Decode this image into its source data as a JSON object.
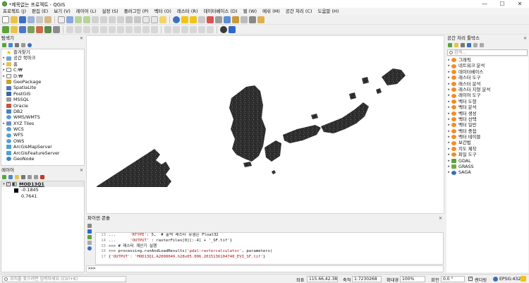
{
  "window": {
    "title": "*제목없는 프로젝트 - QGIS",
    "controls": [
      "—",
      "☐",
      "✕"
    ]
  },
  "menubar": [
    "프로젝트 (J)",
    "편집 (E)",
    "보기 (V)",
    "레이어 (L)",
    "설정 (S)",
    "플러그인 (P)",
    "벡터 (O)",
    "래스터 (R)",
    "데이터베이스 (D)",
    "웹 (W)",
    "메쉬 (M)",
    "공간 처리 (C)",
    "도움말 (H)"
  ],
  "browser_panel": {
    "title": "탐색기",
    "items": [
      {
        "label": "즐겨찾기",
        "icon": "star-icon",
        "arrow": ""
      },
      {
        "label": "공간 북마크",
        "icon": "bookmark-icon",
        "arrow": "▸"
      },
      {
        "label": "홈",
        "icon": "home-folder-icon",
        "arrow": "▸"
      },
      {
        "label": "C:₩",
        "icon": "drive-icon",
        "arrow": "▸"
      },
      {
        "label": "D:₩",
        "icon": "drive-icon",
        "arrow": "▸"
      },
      {
        "label": "GeoPackage",
        "icon": "geopackage-icon",
        "arrow": ""
      },
      {
        "label": "SpatiaLite",
        "icon": "spatialite-icon",
        "arrow": ""
      },
      {
        "label": "PostGIS",
        "icon": "postgis-icon",
        "arrow": ""
      },
      {
        "label": "MSSQL",
        "icon": "mssql-icon",
        "arrow": ""
      },
      {
        "label": "Oracle",
        "icon": "oracle-icon",
        "arrow": ""
      },
      {
        "label": "DB2",
        "icon": "db2-icon",
        "arrow": ""
      },
      {
        "label": "WMS/WMTS",
        "icon": "wms-icon",
        "arrow": ""
      },
      {
        "label": "XYZ Tiles",
        "icon": "xyz-tiles-icon",
        "arrow": "▸"
      },
      {
        "label": "WCS",
        "icon": "wcs-icon",
        "arrow": ""
      },
      {
        "label": "WFS",
        "icon": "wfs-icon",
        "arrow": ""
      },
      {
        "label": "OWS",
        "icon": "ows-icon",
        "arrow": ""
      },
      {
        "label": "ArcGisMapServer",
        "icon": "arcgis-map-icon",
        "arrow": ""
      },
      {
        "label": "ArcGisFeatureServer",
        "icon": "arcgis-feature-icon",
        "arrow": ""
      },
      {
        "label": "GeoNode",
        "icon": "geonode-icon",
        "arrow": ""
      }
    ]
  },
  "layers_panel": {
    "title": "레이어",
    "layer_name": "MOD13Q1",
    "legend_min": "-0.1845",
    "legend_max": "0.7641"
  },
  "processing_panel": {
    "title": "공간 처리 툴박스",
    "search_placeholder": "검색...",
    "items": [
      "그래픽",
      "네트워크 분석",
      "데이터베이스",
      "래스터 도구",
      "래스터 분석",
      "래스터 지형 분석",
      "레이어 도구",
      "벡터 도형",
      "벡터 분석",
      "벡터 생성",
      "벡터 선택",
      "벡터 일반",
      "벡터 중첩",
      "벡터 테이블",
      "보간법",
      "지도 제작",
      "파일 도구",
      "GDAL",
      "GRASS",
      "SAGA"
    ]
  },
  "python_console": {
    "title": "파이썬 콘솔",
    "lines": [
      {
        "n": "13",
        "pre": "...      ",
        "str": "'RTYPE'",
        "post": ": 5,  # 출력 래스터 유형은 Float32"
      },
      {
        "n": "14",
        "pre": "...      ",
        "str": "'OUTPUT'",
        "post": " : rasterFiles[0][:-4] + '_SF.tif'}"
      },
      {
        "n": "15",
        "pre": ">>> # 래스터 계산기 실행",
        "str": "",
        "post": ""
      },
      {
        "n": "16",
        "pre": ">>> processing.runAndLoadResults(",
        "str": "'pdal:rastercalculator'",
        "post": ", parameters)"
      },
      {
        "n": "17",
        "pre": "{",
        "str": "'OUTPUT': 'MOD13Q1.A2000049.h28v05.006.2015136104740_EVI_SF.tif'",
        "post": "}"
      }
    ],
    "prompt": ">>>"
  },
  "statusbar": {
    "locator_placeholder": "위치를 찾으려면 입력하세요 (Ctrl+K)",
    "coord_label": "좌표",
    "coord_value": "115.66,42.38",
    "scale_label": "축척",
    "scale_value": "1:7230268",
    "magnifier_label": "확대경",
    "magnifier_value": "100%",
    "rotation_label": "회전",
    "rotation_value": "0.0 °",
    "render_label": "렌더링",
    "crs_label": "EPSG:4326"
  },
  "colors": {
    "qgis_green": "#5bab3c",
    "raster_dark": "#2b2b2b",
    "folder_yellow": "#e8c24a"
  }
}
